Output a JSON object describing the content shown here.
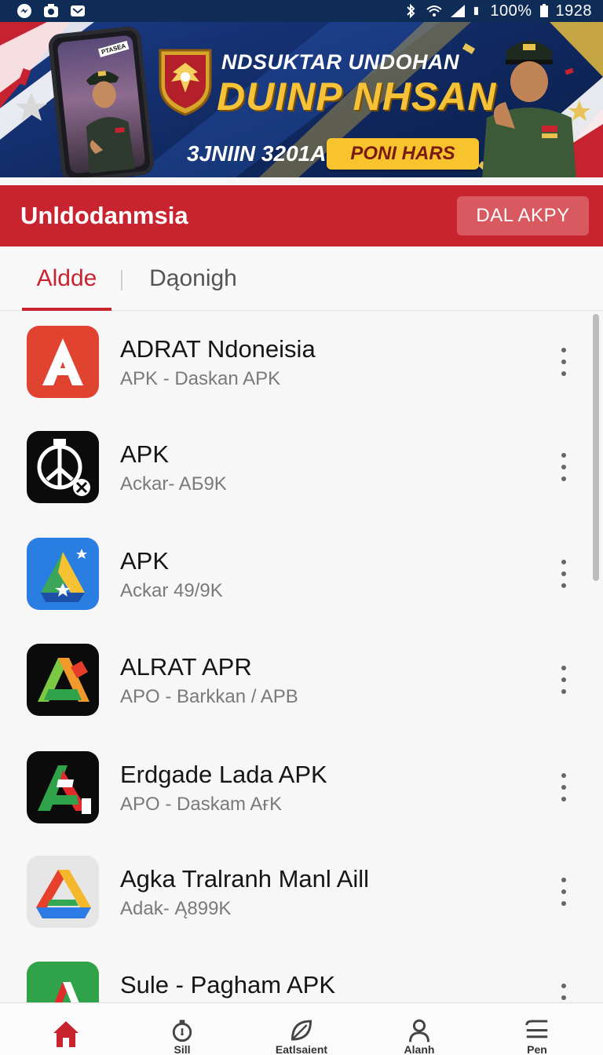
{
  "status_bar": {
    "battery": "100%",
    "time": "1928",
    "left_icons": [
      "messenger-icon",
      "camera-icon",
      "mail-icon"
    ],
    "right_icons": [
      "bluetooth-icon",
      "wifi-icon",
      "signal-icon",
      "battery-icon"
    ]
  },
  "banner": {
    "phone_tag": "PTASEA",
    "title_line1": "NDSUKTAR UNDOHAN",
    "title_line2": "DUINP NHSAN",
    "date": "3JNIIN 3201A",
    "pill_label": "PONI HARS"
  },
  "header": {
    "title": "Unldodanmsia",
    "action_label": "DAL AKPY",
    "color": "#c8242f"
  },
  "tabs": [
    {
      "label": "Aldde",
      "active": true
    },
    {
      "label": "Dąonigh",
      "active": false
    }
  ],
  "apps": [
    {
      "name": "ADRAT Ndoneisia",
      "subtitle": "APK - Daskan APK",
      "icon": "red-a-icon"
    },
    {
      "name": "APK",
      "subtitle": "Ackar- AБ9K",
      "icon": "peace-clock-icon"
    },
    {
      "name": "APK",
      "subtitle": "Ackar 49/9K",
      "icon": "triangle-star-icon"
    },
    {
      "name": "ALRAT APR",
      "subtitle": "APO - Barkkan / APB",
      "icon": "colorful-a-icon"
    },
    {
      "name": "Erdgade Lada APK",
      "subtitle": "APO - Daskam AғK",
      "icon": "flag-a-icon"
    },
    {
      "name": "Agka Tralranh Manl Aill",
      "subtitle": "Adak- Ą899K",
      "icon": "drive-triangle-icon"
    },
    {
      "name": "Sule - Pagham APK",
      "subtitle": "",
      "icon": "green-a-icon"
    }
  ],
  "bottom_nav": [
    {
      "label": "",
      "icon": "home-icon",
      "active": true
    },
    {
      "label": "Sill",
      "icon": "timer-icon",
      "active": false
    },
    {
      "label": "Eatlsaient",
      "icon": "leaf-icon",
      "active": false
    },
    {
      "label": "Alanh",
      "icon": "person-icon",
      "active": false
    },
    {
      "label": "Pen",
      "icon": "menu-icon",
      "active": false
    }
  ]
}
